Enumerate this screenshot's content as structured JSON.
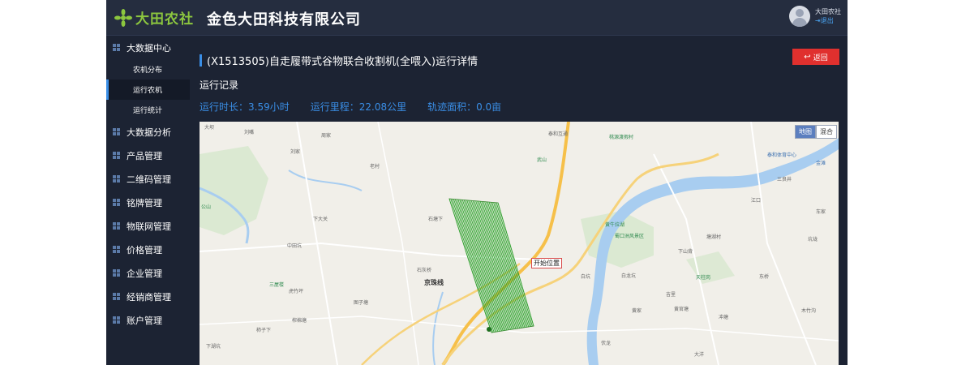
{
  "brand": {
    "name": "大田农社",
    "company": "金色大田科技有限公司"
  },
  "user": {
    "name": "大田农社",
    "logout_label": "退出"
  },
  "sidebar": {
    "groups": [
      {
        "label": "大数据中心",
        "children": [
          "农机分布",
          "运行农机",
          "运行统计"
        ],
        "active_child": "运行农机"
      },
      {
        "label": "大数据分析"
      },
      {
        "label": "产品管理"
      },
      {
        "label": "二维码管理"
      },
      {
        "label": "铭牌管理"
      },
      {
        "label": "物联网管理"
      },
      {
        "label": "价格管理"
      },
      {
        "label": "企业管理"
      },
      {
        "label": "经销商管理"
      },
      {
        "label": "账户管理"
      }
    ]
  },
  "page": {
    "title": "(X1513505)自走履带式谷物联合收割机(全喂入)运行详情",
    "back_label": "返回",
    "section_label": "运行记录",
    "stats": {
      "duration": "运行时长：3.59小时",
      "distance": "运行里程：22.08公里",
      "area": "轨迹面积：0.0亩"
    }
  },
  "map": {
    "switch": {
      "map": "地图",
      "hybrid": "混合"
    },
    "start_label": "开始位置",
    "road_label": "京珠线",
    "places": [
      {
        "text": "大坝",
        "kind": "plain"
      },
      {
        "text": "刘嘴",
        "kind": "plain"
      },
      {
        "text": "刘家",
        "kind": "plain"
      },
      {
        "text": "老村",
        "kind": "plain"
      },
      {
        "text": "周家",
        "kind": "plain"
      },
      {
        "text": "公山",
        "kind": "green"
      },
      {
        "text": "下大关",
        "kind": "plain"
      },
      {
        "text": "中田坑",
        "kind": "plain"
      },
      {
        "text": "三屋楼",
        "kind": "green"
      },
      {
        "text": "虎竹坪",
        "kind": "plain"
      },
      {
        "text": "图子塘",
        "kind": "plain"
      },
      {
        "text": "柿子下",
        "kind": "plain"
      },
      {
        "text": "榨棉塘",
        "kind": "plain"
      },
      {
        "text": "下湖坑",
        "kind": "plain"
      },
      {
        "text": "石塘下",
        "kind": "plain"
      },
      {
        "text": "石灰桥",
        "kind": "plain"
      },
      {
        "text": "泰和互通",
        "kind": "plain"
      },
      {
        "text": "桃源渡假村",
        "kind": "green"
      },
      {
        "text": "武山",
        "kind": "green"
      },
      {
        "text": "黄牛拉湖",
        "kind": "green"
      },
      {
        "text": "蜀口洲风景区",
        "kind": "green"
      },
      {
        "text": "天柱岗",
        "kind": "green"
      },
      {
        "text": "泰和体育中心",
        "kind": "blue"
      },
      {
        "text": "金滩",
        "kind": "blue"
      },
      {
        "text": "三良井",
        "kind": "plain"
      },
      {
        "text": "江口",
        "kind": "plain"
      },
      {
        "text": "车家",
        "kind": "plain"
      },
      {
        "text": "塘湖村",
        "kind": "plain"
      },
      {
        "text": "下山背",
        "kind": "plain"
      },
      {
        "text": "白坑",
        "kind": "plain"
      },
      {
        "text": "黄家",
        "kind": "plain"
      },
      {
        "text": "白龙坑",
        "kind": "plain"
      },
      {
        "text": "黄官塘",
        "kind": "plain"
      },
      {
        "text": "冲塘",
        "kind": "plain"
      },
      {
        "text": "大洋",
        "kind": "plain"
      },
      {
        "text": "木竹沟",
        "kind": "plain"
      },
      {
        "text": "坑垅",
        "kind": "plain"
      },
      {
        "text": "伏龙",
        "kind": "plain"
      },
      {
        "text": "吉里",
        "kind": "plain"
      },
      {
        "text": "东桥",
        "kind": "plain"
      }
    ]
  },
  "colors": {
    "accent": "#3a8ee6",
    "back_button": "#e0302e",
    "sidebar_bg": "#1c2333",
    "track": "#2fa52f"
  }
}
